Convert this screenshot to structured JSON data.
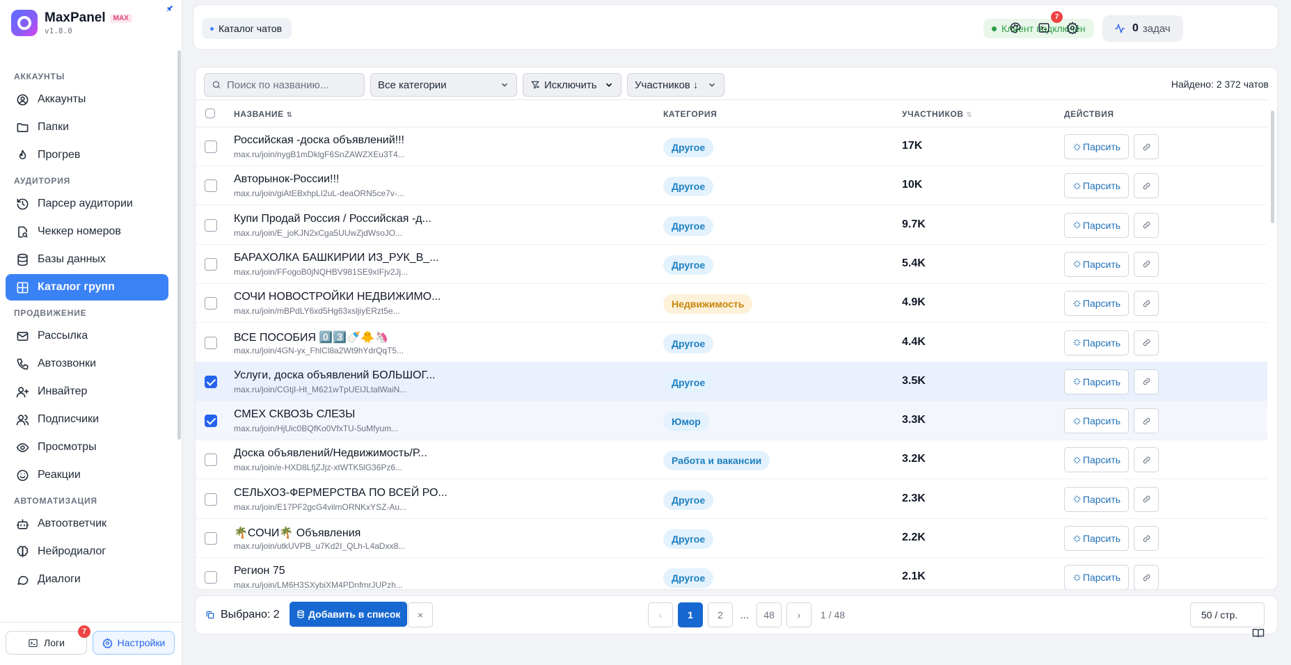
{
  "brand": {
    "name": "MaxPanel",
    "badge": "MAX",
    "version": "v1.8.0"
  },
  "sidebar": {
    "sections": [
      {
        "title": "АККАУНТЫ",
        "items": [
          {
            "label": "Аккаунты",
            "icon": "user-circle-icon"
          },
          {
            "label": "Папки",
            "icon": "folder-icon"
          },
          {
            "label": "Прогрев",
            "icon": "flame-icon"
          }
        ]
      },
      {
        "title": "АУДИТОРИЯ",
        "items": [
          {
            "label": "Парсер аудитории",
            "icon": "history-icon"
          },
          {
            "label": "Чеккер номеров",
            "icon": "file-search-icon"
          },
          {
            "label": "Базы данных",
            "icon": "database-icon"
          },
          {
            "label": "Каталог групп",
            "icon": "grid-icon",
            "active": true
          }
        ]
      },
      {
        "title": "ПРОДВИЖЕНИЕ",
        "items": [
          {
            "label": "Рассылка",
            "icon": "mail-icon"
          },
          {
            "label": "Автозвонки",
            "icon": "phone-icon"
          },
          {
            "label": "Инвайтер",
            "icon": "user-plus-icon"
          },
          {
            "label": "Подписчики",
            "icon": "users-icon"
          },
          {
            "label": "Просмотры",
            "icon": "eye-icon"
          },
          {
            "label": "Реакции",
            "icon": "smile-icon"
          }
        ]
      },
      {
        "title": "АВТОМАТИЗАЦИЯ",
        "items": [
          {
            "label": "Автоответчик",
            "icon": "bot-icon"
          },
          {
            "label": "Нейродиалог",
            "icon": "brain-icon"
          },
          {
            "label": "Диалоги",
            "icon": "chat-icon"
          }
        ]
      }
    ],
    "logs_label": "Логи",
    "logs_badge": "7",
    "settings_label": "Настройки"
  },
  "topbar": {
    "breadcrumb": "Каталог чатов",
    "client_status": "Клиент подключён",
    "tasks_count": "0",
    "tasks_label": "задач",
    "terminal_badge": "7"
  },
  "filters": {
    "search_placeholder": "Поиск по названию...",
    "category": "Все категории",
    "exclude": "Исключить",
    "sort": "Участников ↓",
    "found": "Найдено: 2 372 чатов"
  },
  "table": {
    "headers": {
      "name": "НАЗВАНИЕ",
      "category": "КАТЕГОРИЯ",
      "members": "УЧАСТНИКОВ",
      "actions": "ДЕЙСТВИЯ"
    },
    "parse_label": "Парсить",
    "rows": [
      {
        "title": "Российская -доска объявлений!!!",
        "link": "max.ru/join/nygB1mDklgF6SnZAWZXEu3T4...",
        "category": "Другое",
        "cat_type": "other",
        "members": "17K",
        "checked": false
      },
      {
        "title": "Авторынок-России!!!",
        "link": "max.ru/join/giAtEBxhpLI2uL-deaORN5ce7v-...",
        "category": "Другое",
        "cat_type": "other",
        "members": "10K",
        "checked": false
      },
      {
        "title": "Купи Продай Россия / Российская -д...",
        "link": "max.ru/join/E_joKJN2xCga5UUwZjdWsoJO...",
        "category": "Другое",
        "cat_type": "other",
        "members": "9.7K",
        "checked": false
      },
      {
        "title": "БАРАХОЛКА БАШКИРИИ ИЗ_РУК_В_...",
        "link": "max.ru/join/FFogoB0jNQHBV981SE9xIFjv2Jj...",
        "category": "Другое",
        "cat_type": "other",
        "members": "5.4K",
        "checked": false
      },
      {
        "title": "СОЧИ НОВОСТРОЙКИ НЕДВИЖИМО...",
        "link": "max.ru/join/mBPdLY6xd5Hg63xsljiyERzt5e...",
        "category": "Недвижимость",
        "cat_type": "realty",
        "members": "4.9K",
        "checked": false
      },
      {
        "title": "ВСЕ ПОСОБИЯ 0️⃣3️⃣🍼🐥🦄",
        "link": "max.ru/join/4GN-yx_FhlCl8a2Wt9hYdrQqT5...",
        "category": "Другое",
        "cat_type": "other",
        "members": "4.4K",
        "checked": false
      },
      {
        "title": "Услуги, доска объявлений БОЛЬШОГ...",
        "link": "max.ru/join/CGtjI-Ht_M621wTpUElJLtalWaiN...",
        "category": "Другое",
        "cat_type": "other",
        "members": "3.5K",
        "checked": true
      },
      {
        "title": "СМЕХ СКВОЗЬ СЛЕЗЫ",
        "link": "max.ru/join/HjUic0BQfKo0VfxTU-5uMfyum...",
        "category": "Юмор",
        "cat_type": "other",
        "members": "3.3K",
        "checked": true
      },
      {
        "title": "Доска объявлений/Недвижимость/Р...",
        "link": "max.ru/join/e-HXD8LfjZJjz-xtWTK5lG36Pz6...",
        "category": "Работа и вакансии",
        "cat_type": "other",
        "members": "3.2K",
        "checked": false
      },
      {
        "title": "СЕЛЬХОЗ-ФЕРМЕРСТВА ПО ВСЕЙ РО...",
        "link": "max.ru/join/E17PF2gcG4vilmORNKxYSZ-Au...",
        "category": "Другое",
        "cat_type": "other",
        "members": "2.3K",
        "checked": false
      },
      {
        "title": "🌴СОЧИ🌴 Объявления",
        "link": "max.ru/join/utkUVPB_u7Kd2I_QLh-L4aDxx8...",
        "category": "Другое",
        "cat_type": "other",
        "members": "2.2K",
        "checked": false
      },
      {
        "title": "Регион 75",
        "link": "max.ru/join/LM6H3SXybiXM4PDnfmrJUPzh...",
        "category": "Другое",
        "cat_type": "other",
        "members": "2.1K",
        "checked": false
      }
    ]
  },
  "bottom": {
    "selected": "Выбрано: 2",
    "add_label": "Добавить в список",
    "clear_label": "×",
    "pages": [
      "1",
      "2",
      "48"
    ],
    "ellipsis": "...",
    "page_info": "1 / 48",
    "per_page": "50 / стр.",
    "prev": "‹",
    "next": "›"
  },
  "colors": {
    "accent": "#3b82f6",
    "primary_btn": "#1769d1",
    "success": "#2f9e44",
    "danger": "#ef4444"
  }
}
